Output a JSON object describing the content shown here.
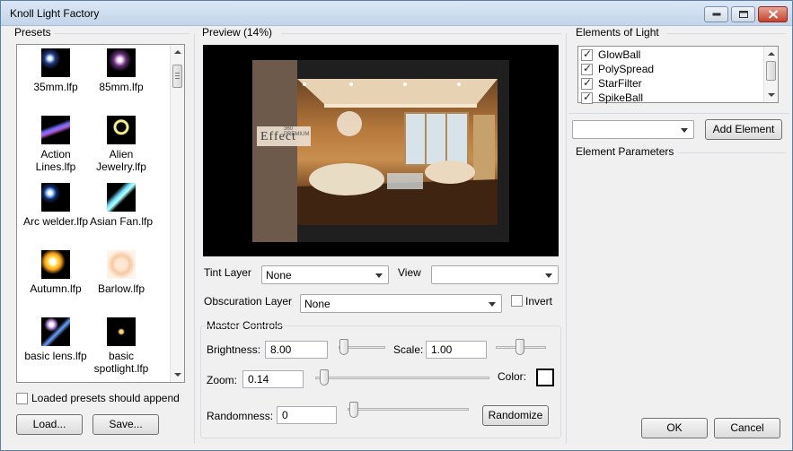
{
  "window": {
    "title": "Knoll Light Factory"
  },
  "presets": {
    "label": "Presets",
    "items": [
      {
        "label": "35mm.lfp",
        "icon": "lens-flare-thumb"
      },
      {
        "label": "85mm.lfp",
        "icon": "lens-flare-thumb"
      },
      {
        "label": "Action Lines.lfp",
        "icon": "lens-flare-thumb"
      },
      {
        "label": "Alien Jewelry.lfp",
        "icon": "lens-flare-thumb"
      },
      {
        "label": "Arc welder.lfp",
        "icon": "lens-flare-thumb"
      },
      {
        "label": "Asian Fan.lfp",
        "icon": "lens-flare-thumb"
      },
      {
        "label": "Autumn.lfp",
        "icon": "lens-flare-thumb"
      },
      {
        "label": "Barlow.lfp",
        "icon": "lens-flare-thumb"
      },
      {
        "label": "basic lens.lfp",
        "icon": "lens-flare-thumb"
      },
      {
        "label": "basic spotlight.lfp",
        "icon": "lens-flare-thumb"
      }
    ],
    "append_label": "Loaded presets should append",
    "append_checked": false,
    "load_label": "Load...",
    "save_label": "Save..."
  },
  "preview": {
    "label": "Preview (14%)",
    "overlay_title": "Effect",
    "overlay_small": "360 PREMIUM"
  },
  "layers": {
    "tint_label": "Tint Layer",
    "tint_value": "None",
    "view_label": "View",
    "view_value": "",
    "obscuration_label": "Obscuration Layer",
    "obscuration_value": "None",
    "invert_label": "Invert",
    "invert_checked": false
  },
  "master": {
    "label": "Master Controls",
    "brightness_label": "Brightness:",
    "brightness_value": "8.00",
    "scale_label": "Scale:",
    "scale_value": "1.00",
    "zoom_label": "Zoom:",
    "zoom_value": "0.14",
    "color_label": "Color:",
    "color_value": "#ffffff",
    "randomness_label": "Randomness:",
    "randomness_value": "0",
    "randomize_label": "Randomize"
  },
  "elements": {
    "label": "Elements of Light",
    "items": [
      {
        "label": "GlowBall",
        "checked": true
      },
      {
        "label": "PolySpread",
        "checked": true
      },
      {
        "label": "StarFilter",
        "checked": true
      },
      {
        "label": "SpikeBall",
        "checked": true
      }
    ],
    "add_select_value": "",
    "add_label": "Add Element",
    "params_label": "Element Parameters"
  },
  "footer": {
    "ok_label": "OK",
    "cancel_label": "Cancel"
  }
}
